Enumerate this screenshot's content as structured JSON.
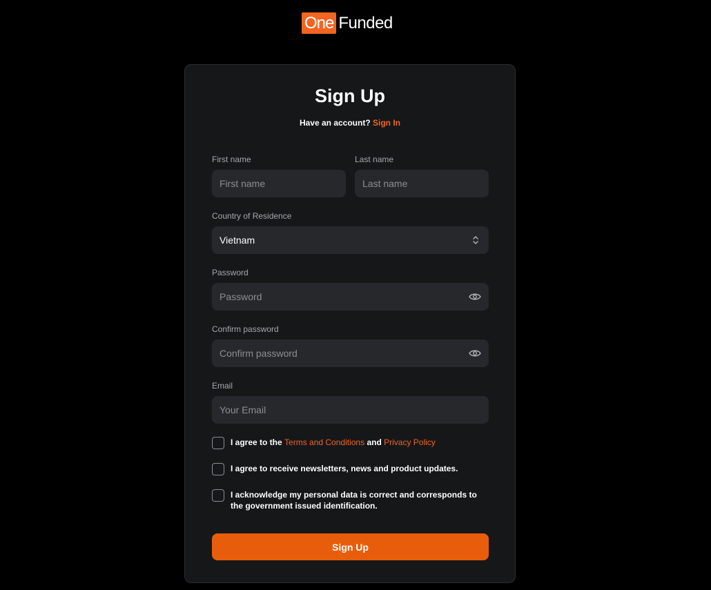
{
  "brand": {
    "badge": "One",
    "rest": "Funded",
    "accent_color": "#f26522"
  },
  "form": {
    "title": "Sign Up",
    "have_account_text": "Have an account?",
    "sign_in_link": "Sign In",
    "first_name": {
      "label": "First name",
      "placeholder": "First name"
    },
    "last_name": {
      "label": "Last name",
      "placeholder": "Last name"
    },
    "country": {
      "label": "Country of Residence",
      "value": "Vietnam"
    },
    "password": {
      "label": "Password",
      "placeholder": "Password"
    },
    "confirm_password": {
      "label": "Confirm password",
      "placeholder": "Confirm password"
    },
    "email": {
      "label": "Email",
      "placeholder": "Your Email"
    },
    "checkboxes": [
      {
        "prefix": "I agree to the",
        "terms_link": "Terms and Conditions",
        "and": "and",
        "privacy_link": "Privacy Policy",
        "checked": false
      },
      {
        "text": "I agree to receive newsletters, news and product updates.",
        "checked": false
      },
      {
        "text": "I acknowledge my personal data is correct and corresponds to the government issued identification.",
        "checked": false
      }
    ],
    "submit_label": "Sign Up",
    "icons": [
      "chevron-up-down-icon",
      "eye-icon"
    ]
  }
}
